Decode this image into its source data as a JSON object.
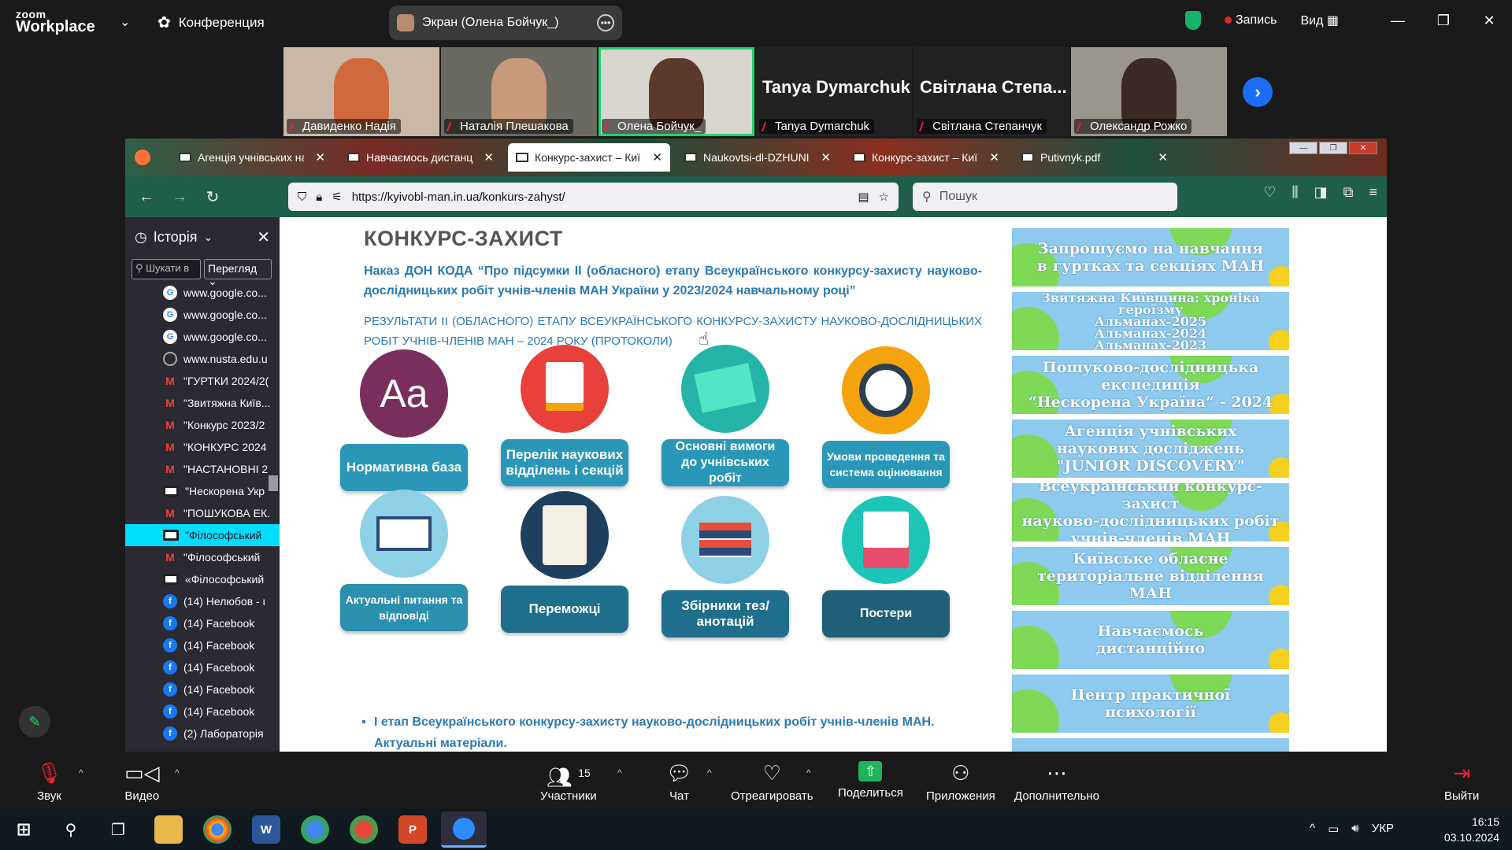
{
  "zoom": {
    "logo_small": "zoom",
    "logo_big": "Workplace",
    "meeting_label": "Конференция",
    "screen_share_label": "Экран (Олена Бойчук_)",
    "record_label": "Запись",
    "view_label": "Вид",
    "participants": [
      {
        "name": "Давиденко Надія",
        "video": true,
        "bg": "#c9b8a6",
        "face": "#d06a3c"
      },
      {
        "name": "Наталія Плешакова",
        "video": true,
        "bg": "#6b6a62",
        "face": "#c79a7b"
      },
      {
        "name": "Олена Бойчук_",
        "video": true,
        "bg": "#d8d6cf",
        "face": "#5b3a2c",
        "active": true
      },
      {
        "name": "Tanya Dymarchuk",
        "big": "Tanya Dymarchuk",
        "video": false
      },
      {
        "name": "Світлана Степанчук",
        "big": "Світлана Степа...",
        "video": false
      },
      {
        "name": "Олександр Рожко",
        "video": true,
        "bg": "#9a958d",
        "face": "#3a2a26"
      }
    ],
    "toolbar": {
      "audio": "Звук",
      "video": "Видео",
      "participants": "Участники",
      "participants_count": "15",
      "chat": "Чат",
      "react": "Отреагировать",
      "share": "Поделиться",
      "apps": "Приложения",
      "more": "Дополнительно",
      "leave": "Выйти"
    }
  },
  "browser": {
    "tabs": [
      {
        "label": "Агенція учнівських на"
      },
      {
        "label": "Навчаємось дистанції"
      },
      {
        "label": "Конкурс-захист – Київ",
        "selected": true
      },
      {
        "label": "Naukovtsi-dl-DZHUNI"
      },
      {
        "label": "Конкурс-захист – Київ"
      },
      {
        "label": "Putivnyk.pdf"
      }
    ],
    "url": "https://kyivobl-man.in.ua/konkurs-zahyst/",
    "search_placeholder": "Пошук",
    "sidebar": {
      "title": "Історія",
      "search_placeholder": "Шукати в",
      "view_label": "Перегляд",
      "items": [
        {
          "icon": "g",
          "label": "www.google.co..."
        },
        {
          "icon": "g",
          "label": "www.google.co..."
        },
        {
          "icon": "g",
          "label": "www.google.co..."
        },
        {
          "icon": "w",
          "label": "www.nusta.edu.u"
        },
        {
          "icon": "m",
          "label": "\"ГУРТКИ 2024/2("
        },
        {
          "icon": "m",
          "label": "\"Звитяжна Київ..."
        },
        {
          "icon": "m",
          "label": "\"Конкурс 2023/2"
        },
        {
          "icon": "m",
          "label": "\"КОНКУРС 2024"
        },
        {
          "icon": "m",
          "label": "\"НАСТАНОВНІ 2"
        },
        {
          "icon": "s",
          "label": "\"Нескорена Укр"
        },
        {
          "icon": "m",
          "label": "\"ПОШУКОВА ЕК."
        },
        {
          "icon": "s",
          "label": "\"Філософський",
          "selected": true
        },
        {
          "icon": "m",
          "label": "\"Філософський"
        },
        {
          "icon": "s",
          "label": "«Філософський"
        },
        {
          "icon": "f",
          "label": "(14) Нелюбов - ι"
        },
        {
          "icon": "f",
          "label": "(14) Facebook"
        },
        {
          "icon": "f",
          "label": "(14) Facebook"
        },
        {
          "icon": "f",
          "label": "(14) Facebook"
        },
        {
          "icon": "f",
          "label": "(14) Facebook"
        },
        {
          "icon": "f",
          "label": "(14) Facebook"
        },
        {
          "icon": "f",
          "label": "(2) Лабораторія"
        }
      ]
    }
  },
  "page": {
    "title": "КОНКУРС-ЗАХИСТ",
    "order_link": "Наказ ДОН КОДА “Про підсумки ІІ (обласного) етапу Всеукраїнського конкурсу-захисту науково-дослідницьких робіт учнів-членів МАН України у 2023/2024 навчальному році”",
    "results_link": "РЕЗУЛЬТАТИ ІІ (ОБЛАСНОГО) ЕТАПУ ВСЕУКРАЇНСЬКОГО КОНКУРСУ-ЗАХИСТУ НАУКОВО-ДОСЛІДНИЦЬКИХ РОБІТ УЧНІВ-ЧЛЕНІВ МАН – 2024 РОКУ (ПРОТОКОЛИ)",
    "tiles": [
      {
        "label": "Нормативна база",
        "icon": "font-icon",
        "circle": "#7a2e5c",
        "btn": "#2b97b8",
        "fs": 17
      },
      {
        "label": "Перелік наукових відділень і секцій",
        "icon": "document-download-icon",
        "circle": "#e8413c",
        "btn": "#2b97b8",
        "fs": 17
      },
      {
        "label": "Основні вимоги до учнівських робіт",
        "icon": "notes-pin-icon",
        "circle": "#24b5a8",
        "btn": "#2b97b8",
        "fs": 16
      },
      {
        "label": "Умови проведення та система оцінювання",
        "icon": "compass-icon",
        "circle": "#f5a30c",
        "btn": "#2b97b8",
        "fs": 14
      },
      {
        "label": "Актуальні питання та відповіді",
        "icon": "monitor-search-icon",
        "circle": "#8ed0e6",
        "btn": "#2b8fae",
        "fs": 14
      },
      {
        "label": "Переможці",
        "icon": "certificate-icon",
        "circle": "#1f3f5f",
        "btn": "#1f6e8c",
        "fs": 17
      },
      {
        "label": "Збірники тез/анотацій",
        "icon": "books-icon",
        "circle": "#8ed0e6",
        "btn": "#1f6e8c",
        "fs": 17
      },
      {
        "label": "Постери",
        "icon": "poster-icon",
        "circle": "#1cc5b8",
        "btn": "#1f5f78",
        "fs": 16
      }
    ],
    "bullet": "І етап Всеукраїнського конкурсу-захисту науково-дослідницьких робіт учнів-членів МАН. Актуальні матеріали.",
    "banners": [
      {
        "lines": [
          "Запрошуємо на навчання",
          "в гуртках та секціях МАН"
        ]
      },
      {
        "lines": [
          "Звитяжна Київщина: хроніка героїзму",
          "Альманах-2025",
          "Альманах-2024",
          "Альманах-2023"
        ],
        "small": true
      },
      {
        "lines": [
          "Пошуково-дослідницька",
          "експедиція",
          "“Нескорена Україна” - 2024"
        ]
      },
      {
        "lines": [
          "Агенція учнівських",
          "наукових досліджень",
          "\"JUNIOR DISCOVERY\""
        ]
      },
      {
        "lines": [
          "Всеукраїнський конкурс-захист",
          "науково-дослідницьких робіт",
          "учнів-членів МАН"
        ]
      },
      {
        "lines": [
          "Київське обласне",
          "територіальне відділення",
          "МАН"
        ]
      },
      {
        "lines": [
          "Навчаємось",
          "дистанційно"
        ]
      },
      {
        "lines": [
          "Центр практичної",
          "психології"
        ]
      }
    ]
  },
  "taskbar": {
    "lang": "УКР",
    "time": "16:15",
    "date": "03.10.2024"
  }
}
